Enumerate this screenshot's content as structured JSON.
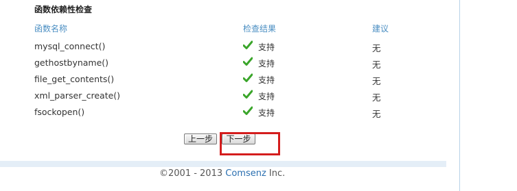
{
  "section": {
    "title": "函数依赖性检查"
  },
  "table": {
    "headers": {
      "name": "函数名称",
      "result": "检查结果",
      "advice": "建议"
    },
    "rows": [
      {
        "name": "mysql_connect()",
        "result": "支持",
        "advice": "无"
      },
      {
        "name": "gethostbyname()",
        "result": "支持",
        "advice": "无"
      },
      {
        "name": "file_get_contents()",
        "result": "支持",
        "advice": "无"
      },
      {
        "name": "xml_parser_create()",
        "result": "支持",
        "advice": "无"
      },
      {
        "name": "fsockopen()",
        "result": "支持",
        "advice": "无"
      }
    ]
  },
  "buttons": {
    "prev_label": "上一步",
    "next_label": "下一步"
  },
  "footer": {
    "prefix": "©2001 - 2013 ",
    "brand": "Comsenz",
    "suffix": " Inc."
  },
  "colors": {
    "header_text": "#4a8ec2",
    "check_green": "#3aa52a",
    "highlight": "#d41d1d",
    "footer_bar": "#e4eef7"
  },
  "icons": {
    "result_icon": "check-icon"
  }
}
